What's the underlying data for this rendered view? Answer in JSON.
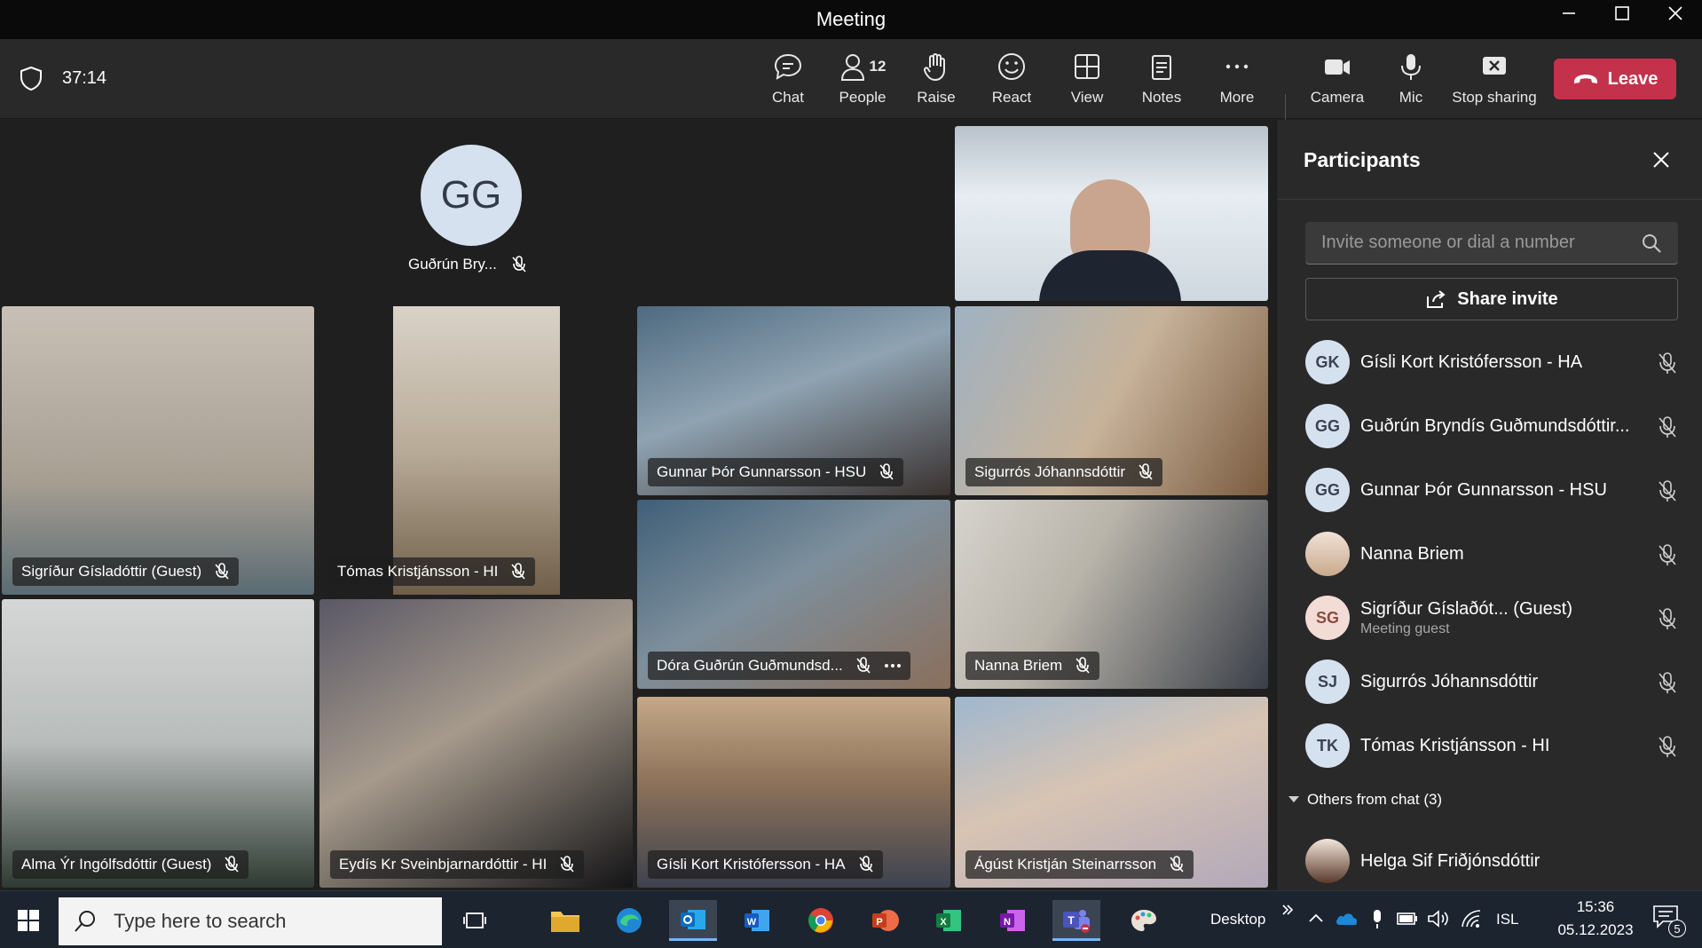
{
  "window": {
    "title": "Meeting"
  },
  "toolbar": {
    "timer": "37:14",
    "people_count": "12",
    "buttons": {
      "chat": "Chat",
      "people": "People",
      "raise": "Raise",
      "react": "React",
      "view": "View",
      "notes": "Notes",
      "more": "More",
      "camera": "Camera",
      "mic": "Mic",
      "stop_sharing": "Stop sharing"
    },
    "leave_label": "Leave",
    "leave_color": "#c4314b",
    "accent_color": "#7f85f5"
  },
  "stage": {
    "avatar_tile": {
      "initials": "GG",
      "name": "Guðrún Bry..."
    },
    "tiles": [
      {
        "name": "Sigríður Gísladóttir (Guest)"
      },
      {
        "name": "Tómas Kristjánsson - HI"
      },
      {
        "name": "Gunnar Þór Gunnarsson - HSU"
      },
      {
        "name": "Sigurrós Jóhannsdóttir"
      },
      {
        "name": "Dóra Guðrún Guðmundsd..."
      },
      {
        "name": "Nanna Briem"
      },
      {
        "name": "Alma Ýr Ingólfsdóttir (Guest)"
      },
      {
        "name": "Eydís Kr Sveinbjarnardóttir - HI"
      },
      {
        "name": "Gísli Kort Kristófersson - HA"
      },
      {
        "name": "Ágúst Kristján Steinarrsson"
      }
    ]
  },
  "panel": {
    "title": "Participants",
    "invite_placeholder": "Invite someone or dial a number",
    "share_invite": "Share invite",
    "participants": [
      {
        "initials": "GK",
        "name": "Gísli Kort Kristófersson - HA"
      },
      {
        "initials": "GG",
        "name": "Guðrún Bryndís Guðmundsdóttir..."
      },
      {
        "initials": "GG",
        "name": "Gunnar Þór Gunnarsson - HSU"
      },
      {
        "initials": "",
        "name": "Nanna Briem"
      },
      {
        "initials": "SG",
        "name": "Sigríður Gíslaðót... (Guest)",
        "sub": "Meeting guest"
      },
      {
        "initials": "SJ",
        "name": "Sigurrós Jóhannsdóttir"
      },
      {
        "initials": "TK",
        "name": "Tómas Kristjánsson - HI"
      }
    ],
    "others_label": "Others from chat (3)",
    "others": [
      {
        "name": "Helga Sif Friðjónsdóttir"
      }
    ]
  },
  "taskbar": {
    "search_placeholder": "Type here to search",
    "desktop_label": "Desktop",
    "lang": "ISL",
    "time": "15:36",
    "date": "05.12.2023",
    "notification_count": "5"
  }
}
